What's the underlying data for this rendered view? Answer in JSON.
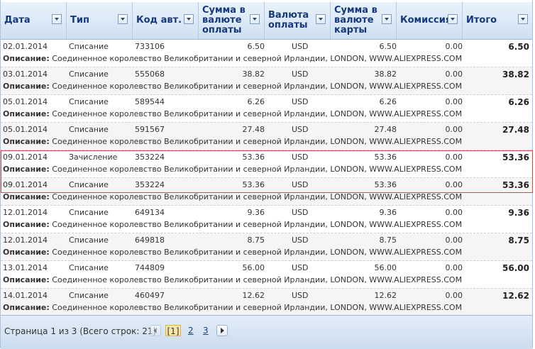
{
  "columns": [
    {
      "label": "Дата"
    },
    {
      "label": "Тип"
    },
    {
      "label": "Код авт."
    },
    {
      "label": "Сумма в валюте оплаты"
    },
    {
      "label": "Валюта оплаты"
    },
    {
      "label": "Сумма в валюте карты"
    },
    {
      "label": "Комиссия"
    },
    {
      "label": "Итого"
    }
  ],
  "description_label": "Описание:",
  "rows": [
    {
      "date": "02.01.2014",
      "type": "Списание",
      "code": "733106",
      "amount": "6.50",
      "currency": "USD",
      "card_amount": "6.50",
      "fee": "0.00",
      "total": "6.50",
      "desc": "Соединенное королевство Великобритании и северной Ирландии, LONDON, WWW.ALIEXPRESS.COM"
    },
    {
      "date": "03.01.2014",
      "type": "Списание",
      "code": "555068",
      "amount": "38.82",
      "currency": "USD",
      "card_amount": "38.82",
      "fee": "0.00",
      "total": "38.82",
      "desc": "Соединенное королевство Великобритании и северной Ирландии, LONDON, WWW.ALIEXPRESS.COM"
    },
    {
      "date": "05.01.2014",
      "type": "Списание",
      "code": "589544",
      "amount": "6.26",
      "currency": "USD",
      "card_amount": "6.26",
      "fee": "0.00",
      "total": "6.26",
      "desc": "Соединенное королевство Великобритании и северной Ирландии, LONDON, WWW.ALIEXPRESS.COM"
    },
    {
      "date": "05.01.2014",
      "type": "Списание",
      "code": "591567",
      "amount": "27.48",
      "currency": "USD",
      "card_amount": "27.48",
      "fee": "0.00",
      "total": "27.48",
      "desc": "Соединенное королевство Великобритании и северной Ирландии, LONDON, WWW.ALIEXPRESS.COM"
    },
    {
      "date": "09.01.2014",
      "type": "Зачисление",
      "code": "353224",
      "amount": "53.36",
      "currency": "USD",
      "card_amount": "53.36",
      "fee": "0.00",
      "total": "53.36",
      "desc": "Соединенное королевство Великобритании и северной Ирландии, LONDON, WWW.ALIEXPRESS.COM"
    },
    {
      "date": "09.01.2014",
      "type": "Списание",
      "code": "353224",
      "amount": "53.36",
      "currency": "USD",
      "card_amount": "53.36",
      "fee": "0.00",
      "total": "53.36",
      "desc": "Соединенное королевство Великобритании и северной Ирландии, LONDON, WWW.ALIEXPRESS.COM"
    },
    {
      "date": "12.01.2014",
      "type": "Списание",
      "code": "649134",
      "amount": "9.36",
      "currency": "USD",
      "card_amount": "9.36",
      "fee": "0.00",
      "total": "9.36",
      "desc": "Соединенное королевство Великобритании и северной Ирландии, LONDON, WWW.ALIEXPRESS.COM"
    },
    {
      "date": "12.01.2014",
      "type": "Списание",
      "code": "649818",
      "amount": "8.75",
      "currency": "USD",
      "card_amount": "8.75",
      "fee": "0.00",
      "total": "8.75",
      "desc": "Соединенное королевство Великобритании и северной Ирландии, LONDON, WWW.ALIEXPRESS.COM"
    },
    {
      "date": "13.01.2014",
      "type": "Списание",
      "code": "744809",
      "amount": "56.00",
      "currency": "USD",
      "card_amount": "56.00",
      "fee": "0.00",
      "total": "56.00",
      "desc": "Соединенное королевство Великобритании и северной Ирландии, LONDON, WWW.ALIEXPRESS.COM"
    },
    {
      "date": "14.01.2014",
      "type": "Списание",
      "code": "460497",
      "amount": "12.62",
      "currency": "USD",
      "card_amount": "12.62",
      "fee": "0.00",
      "total": "12.62",
      "desc": "Соединенное королевство Великобритании и северной Ирландии, LONDON, WWW.ALIEXPRESS.COM"
    }
  ],
  "pager": {
    "info": "Страница 1 из 3 (Всего строк: 21)",
    "current": "[1]",
    "page2": "2",
    "page3": "3"
  },
  "colors": {
    "highlight": "#c0504d",
    "header_text": "#16387c"
  }
}
